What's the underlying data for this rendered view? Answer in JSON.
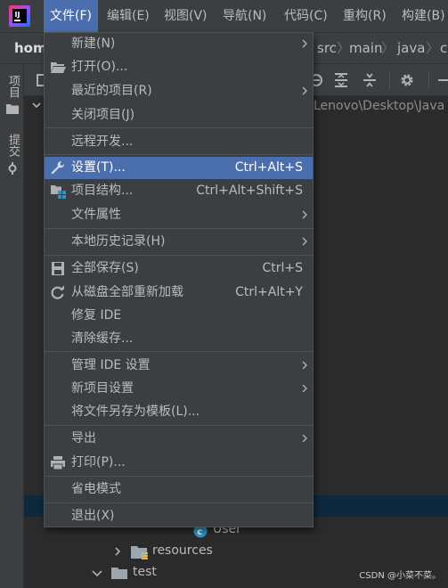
{
  "menubar": {
    "items": [
      "文件(F)",
      "编辑(E)",
      "视图(V)",
      "导航(N)",
      "代码(C)",
      "重构(R)",
      "构建(B)"
    ],
    "active_index": 0
  },
  "navbar": {
    "project": "hom",
    "crumbs": [
      "src",
      "main",
      "java",
      "c"
    ]
  },
  "left_strip": {
    "tabs": [
      "项目",
      "提交"
    ]
  },
  "project_panel": {
    "path_text": "Lenovo\\Desktop\\Java",
    "tree": [
      {
        "label": "User",
        "icon": "class-icon"
      },
      {
        "label": "resources",
        "icon": "folder-icon"
      },
      {
        "label": "test",
        "icon": "folder-icon"
      }
    ]
  },
  "file_menu": {
    "items": [
      {
        "label": "新建(N)",
        "shortcut": "",
        "submenu": true,
        "icon": ""
      },
      {
        "label": "打开(O)...",
        "shortcut": "",
        "submenu": false,
        "icon": "folder-open-icon"
      },
      {
        "label": "最近的项目(R)",
        "shortcut": "",
        "submenu": true,
        "icon": ""
      },
      {
        "label": "关闭项目(J)",
        "shortcut": "",
        "submenu": false,
        "icon": ""
      },
      {
        "label": "远程开发...",
        "shortcut": "",
        "submenu": false,
        "icon": ""
      },
      {
        "label": "设置(T)...",
        "shortcut": "Ctrl+Alt+S",
        "submenu": false,
        "icon": "wrench-icon",
        "highlighted": true
      },
      {
        "label": "项目结构...",
        "shortcut": "Ctrl+Alt+Shift+S",
        "submenu": false,
        "icon": "project-structure-icon"
      },
      {
        "label": "文件属性",
        "shortcut": "",
        "submenu": true,
        "icon": ""
      },
      {
        "label": "本地历史记录(H)",
        "shortcut": "",
        "submenu": true,
        "icon": ""
      },
      {
        "label": "全部保存(S)",
        "shortcut": "Ctrl+S",
        "submenu": false,
        "icon": "save-icon"
      },
      {
        "label": "从磁盘全部重新加载",
        "shortcut": "Ctrl+Alt+Y",
        "submenu": false,
        "icon": "reload-icon"
      },
      {
        "label": "修复 IDE",
        "shortcut": "",
        "submenu": false,
        "icon": ""
      },
      {
        "label": "清除缓存...",
        "shortcut": "",
        "submenu": false,
        "icon": ""
      },
      {
        "label": "管理 IDE 设置",
        "shortcut": "",
        "submenu": true,
        "icon": ""
      },
      {
        "label": "新项目设置",
        "shortcut": "",
        "submenu": true,
        "icon": ""
      },
      {
        "label": "将文件另存为模板(L)...",
        "shortcut": "",
        "submenu": false,
        "icon": ""
      },
      {
        "label": "导出",
        "shortcut": "",
        "submenu": true,
        "icon": ""
      },
      {
        "label": "打印(P)...",
        "shortcut": "",
        "submenu": false,
        "icon": "print-icon"
      },
      {
        "label": "省电模式",
        "shortcut": "",
        "submenu": false,
        "icon": ""
      },
      {
        "label": "退出(X)",
        "shortcut": "",
        "submenu": false,
        "icon": ""
      }
    ]
  },
  "watermark": "CSDN @小菜不菜。",
  "colors": {
    "highlight": "#4b6eaf",
    "menu_bg": "#3c3f41",
    "editor_bg": "#2b2b2b",
    "selection_bg": "#0d293e"
  }
}
